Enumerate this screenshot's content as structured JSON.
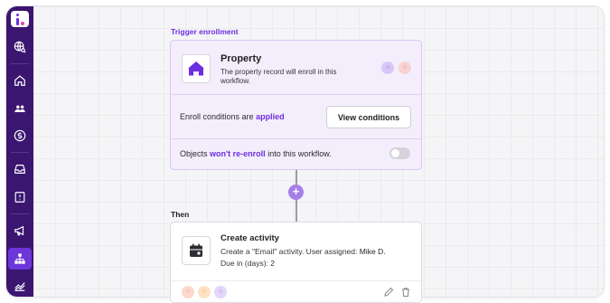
{
  "sidebar": {
    "items": [
      {
        "icon": "globe-search-icon",
        "active": false
      },
      {
        "icon": "home-icon",
        "active": false
      },
      {
        "icon": "contacts-icon",
        "active": false
      },
      {
        "icon": "dollar-icon",
        "active": false
      },
      {
        "icon": "inbox-icon",
        "active": false
      },
      {
        "icon": "list-icon",
        "active": false
      },
      {
        "icon": "megaphone-icon",
        "active": false
      },
      {
        "icon": "workflow-icon",
        "active": true
      },
      {
        "icon": "reports-icon",
        "active": false
      }
    ]
  },
  "trigger": {
    "section_label": "Trigger enrollment",
    "title": "Property",
    "description": "The property record will enroll in this workflow.",
    "enroll_prefix": "Enroll conditions are",
    "enroll_status": "applied",
    "view_button": "View conditions",
    "reenroll_prefix": "Objects",
    "reenroll_accent": "won't re-enroll",
    "reenroll_suffix": "into this workflow.",
    "reenroll_enabled": false
  },
  "then": {
    "section_label": "Then",
    "title": "Create activity",
    "description_line1": "Create a \"Email\" activity. User assigned:",
    "assignee": "Mike D.",
    "description_line2": "Due in (days): 2"
  },
  "colors": {
    "sidebar_bg": "#3b1670",
    "accent": "#6d2ee0",
    "active_nav": "#6d36d9"
  }
}
